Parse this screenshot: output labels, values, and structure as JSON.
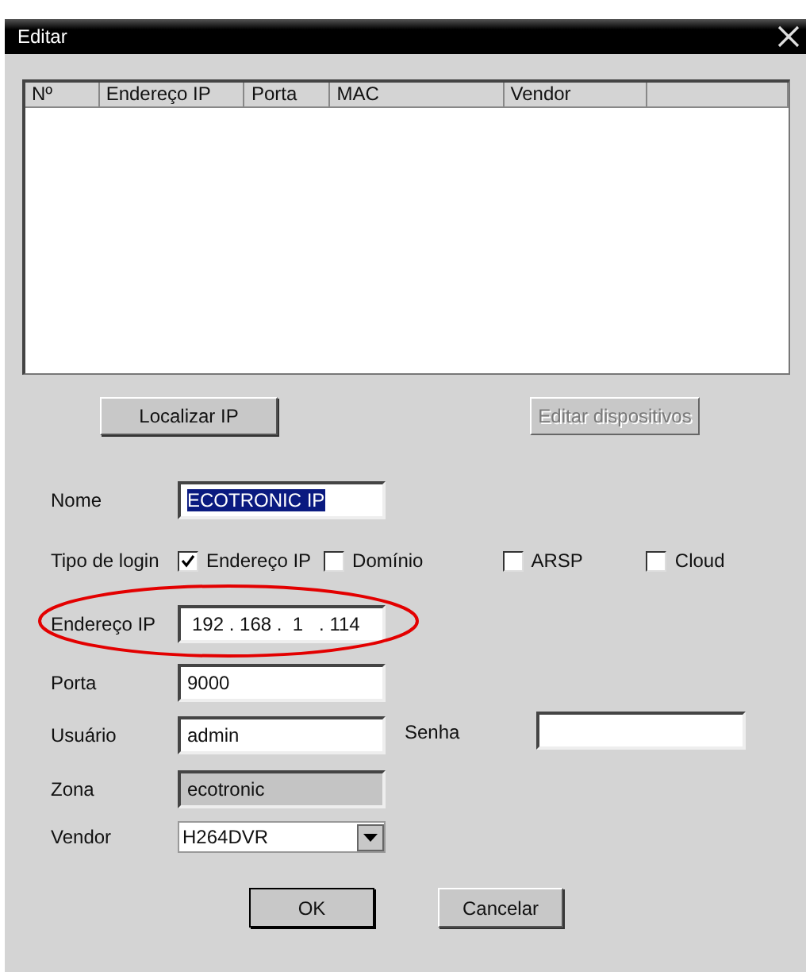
{
  "window": {
    "title": "Editar"
  },
  "device_table": {
    "columns": [
      "Nº",
      "Endereço IP",
      "Porta",
      "MAC",
      "Vendor"
    ]
  },
  "top_buttons": [
    {
      "label": "Localizar IP",
      "disabled": false
    },
    {
      "label": "Editar dispositivos",
      "disabled": true
    }
  ],
  "fields": [
    {
      "kind": "text",
      "label": "Nome",
      "value": "ECOTRONIC IP",
      "text_selected": true,
      "disabled": false
    },
    {
      "kind": "checks",
      "label": "Tipo de login",
      "options": [
        {
          "label": "Endereço IP",
          "checked": true
        },
        {
          "label": "Domínio",
          "checked": false
        },
        {
          "label": "ARSP",
          "checked": false
        },
        {
          "label": "Cloud",
          "checked": false
        }
      ]
    },
    {
      "kind": "ip",
      "label": "Endereço IP",
      "value": "192 . 168 .  1   . 114",
      "disabled": false,
      "annotated": true
    },
    {
      "kind": "text",
      "label": "Porta",
      "value": "9000",
      "disabled": false
    },
    {
      "kind": "text",
      "label": "Usuário",
      "value": "admin",
      "disabled": false,
      "extra": {
        "label": "Senha"
      }
    },
    {
      "kind": "text",
      "label": "Zona",
      "value": "ecotronic",
      "disabled": true
    },
    {
      "kind": "select",
      "label": "Vendor",
      "value": "H264DVR"
    }
  ],
  "bottom_buttons": [
    {
      "label": "OK",
      "default": true
    },
    {
      "label": "Cancelar",
      "default": false
    }
  ]
}
